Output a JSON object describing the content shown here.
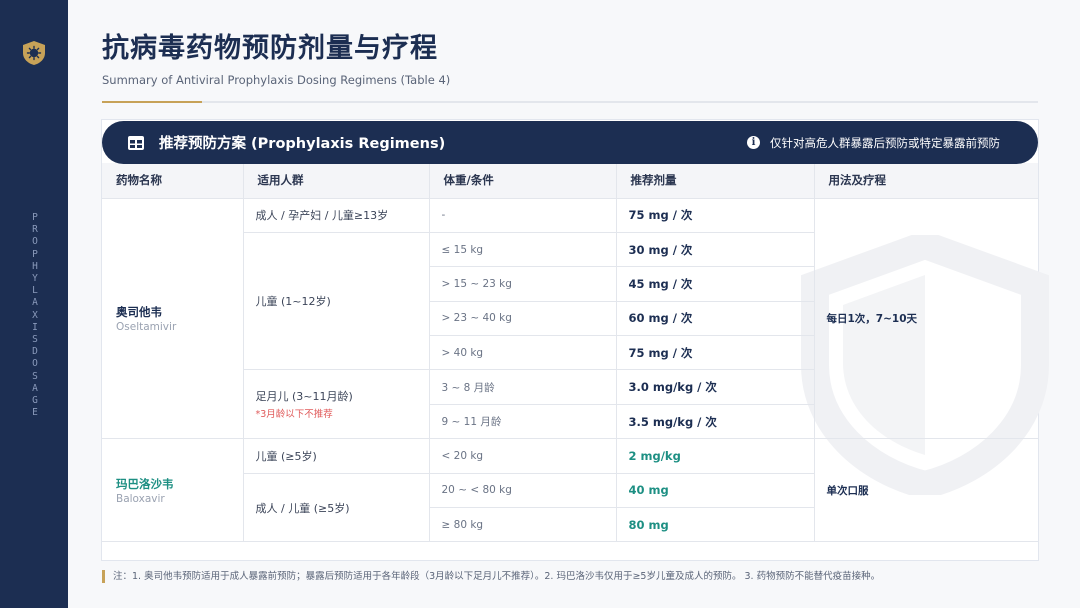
{
  "sidebar": {
    "vertical_text": "PROPHYLAXIS DOSAGE"
  },
  "header": {
    "title": "抗病毒药物预防剂量与疗程",
    "subtitle": "Summary of Antiviral Prophylaxis Dosing Regimens (Table 4)"
  },
  "banner": {
    "title": "推荐预防方案 (Prophylaxis Regimens)",
    "note": "仅针对高危人群暴露后预防或特定暴露前预防"
  },
  "table": {
    "headers": [
      "药物名称",
      "适用人群",
      "体重/条件",
      "推荐剂量",
      "用法及疗程"
    ],
    "oseltamivir": {
      "name": "奥司他韦",
      "name_en": "Oseltamivir",
      "usage": "每日1次，7~10天",
      "group_adult": "成人 / 孕产妇 / 儿童≥13岁",
      "group_child": "儿童 (1~12岁)",
      "group_infant": "足月儿 (3~11月龄)",
      "group_infant_warn": "*3月龄以下不推荐",
      "rows": [
        {
          "cond": "-",
          "dose": "75 mg / 次"
        },
        {
          "cond": "≤ 15 kg",
          "dose": "30 mg / 次"
        },
        {
          "cond": "> 15 ~ 23 kg",
          "dose": "45 mg / 次"
        },
        {
          "cond": "> 23 ~ 40 kg",
          "dose": "60 mg / 次"
        },
        {
          "cond": "> 40 kg",
          "dose": "75 mg / 次"
        },
        {
          "cond": "3 ~ 8 月龄",
          "dose": "3.0 mg/kg / 次"
        },
        {
          "cond": "9 ~ 11 月龄",
          "dose": "3.5 mg/kg / 次"
        }
      ]
    },
    "baloxavir": {
      "name": "玛巴洛沙韦",
      "name_en": "Baloxavir",
      "usage": "单次口服",
      "group_child": "儿童 (≥5岁)",
      "group_adult": "成人 / 儿童 (≥5岁)",
      "rows": [
        {
          "cond": "< 20 kg",
          "dose": "2 mg/kg"
        },
        {
          "cond": "20 ~ < 80 kg",
          "dose": "40 mg"
        },
        {
          "cond": "≥ 80 kg",
          "dose": "80 mg"
        }
      ]
    }
  },
  "footnote": "注：1. 奥司他韦预防适用于成人暴露前预防；暴露后预防适用于各年龄段（3月龄以下足月儿不推荐）。2. 玛巴洛沙韦仅用于≥5岁儿童及成人的预防。 3. 药物预防不能替代疫苗接种。",
  "colors": {
    "navy": "#1c2e52",
    "gold": "#c7a258",
    "teal": "#1d8f83",
    "warn": "#e05a5a"
  }
}
